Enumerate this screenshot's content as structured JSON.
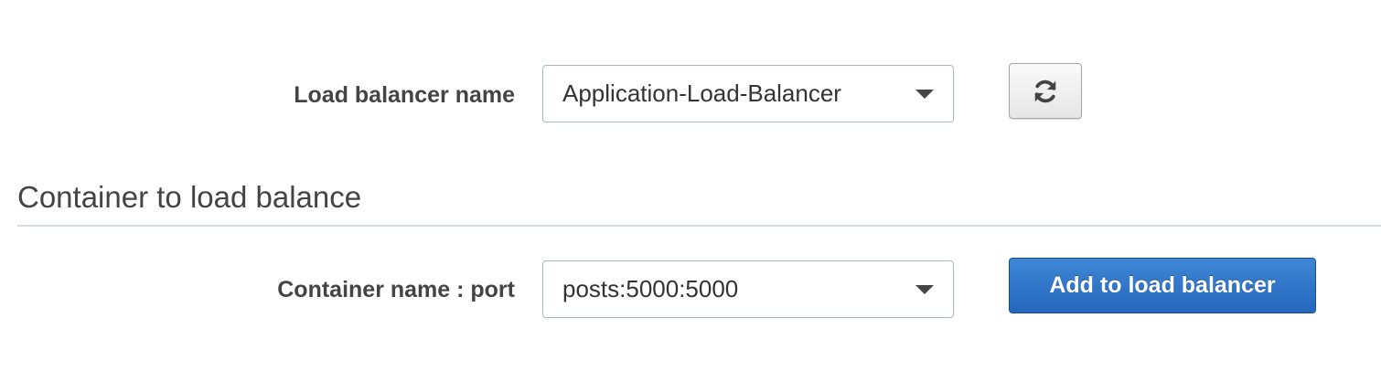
{
  "load_balancer": {
    "label": "Load balancer name",
    "selected": "Application-Load-Balancer",
    "refresh_icon": "refresh-icon"
  },
  "container_section": {
    "title": "Container to load balance",
    "label": "Container name : port",
    "selected": "posts:5000:5000",
    "add_button_label": "Add to load balancer"
  },
  "colors": {
    "primary_button": "#2567bd",
    "divider": "#d5dbdb",
    "text": "#444444"
  }
}
